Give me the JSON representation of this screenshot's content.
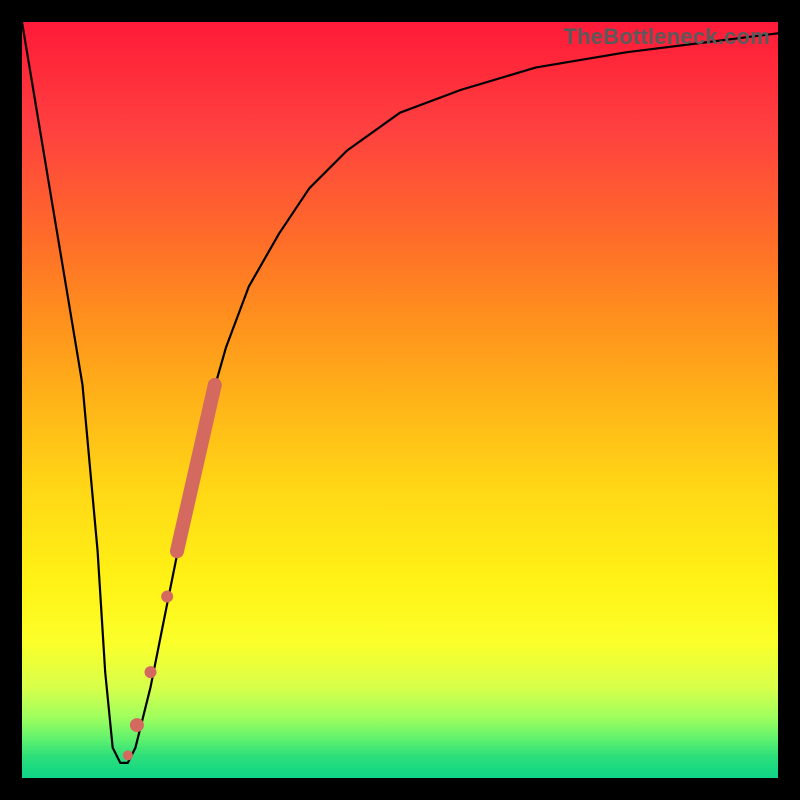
{
  "watermark": "TheBottleneck.com",
  "chart_data": {
    "type": "line",
    "title": "",
    "xlabel": "",
    "ylabel": "",
    "xlim": [
      0,
      100
    ],
    "ylim": [
      0,
      100
    ],
    "grid": false,
    "legend": false,
    "series": [
      {
        "name": "bottleneck-curve",
        "color": "#000000",
        "x": [
          0,
          2,
          4,
          6,
          8,
          10,
          11,
          12,
          13,
          14,
          15,
          17,
          19,
          21,
          23,
          25,
          27,
          30,
          34,
          38,
          43,
          50,
          58,
          68,
          80,
          92,
          100
        ],
        "y": [
          100,
          88,
          76,
          64,
          52,
          30,
          14,
          4,
          2,
          2,
          4,
          12,
          22,
          32,
          42,
          50,
          57,
          65,
          72,
          78,
          83,
          88,
          91,
          94,
          96,
          97.5,
          98.5
        ]
      }
    ],
    "markers": [
      {
        "name": "highlight-segment",
        "color": "#d46a5f",
        "shape": "capsule",
        "x0": 20.5,
        "y0": 30,
        "x1": 25.5,
        "y1": 52,
        "width": 14
      },
      {
        "name": "dot-1",
        "color": "#d46a5f",
        "shape": "circle",
        "x": 19.2,
        "y": 24,
        "r": 6
      },
      {
        "name": "dot-2",
        "color": "#d46a5f",
        "shape": "circle",
        "x": 17.0,
        "y": 14,
        "r": 6
      },
      {
        "name": "dot-3",
        "color": "#d46a5f",
        "shape": "circle",
        "x": 15.2,
        "y": 7,
        "r": 7
      },
      {
        "name": "dot-4",
        "color": "#d46a5f",
        "shape": "circle",
        "x": 14.0,
        "y": 3,
        "r": 5
      }
    ],
    "background_gradient": {
      "direction": "vertical",
      "stops": [
        {
          "pos": 0.0,
          "color": "#ff1a3a"
        },
        {
          "pos": 0.5,
          "color": "#ffb318"
        },
        {
          "pos": 0.8,
          "color": "#fcff2a"
        },
        {
          "pos": 1.0,
          "color": "#10d586"
        }
      ]
    }
  }
}
